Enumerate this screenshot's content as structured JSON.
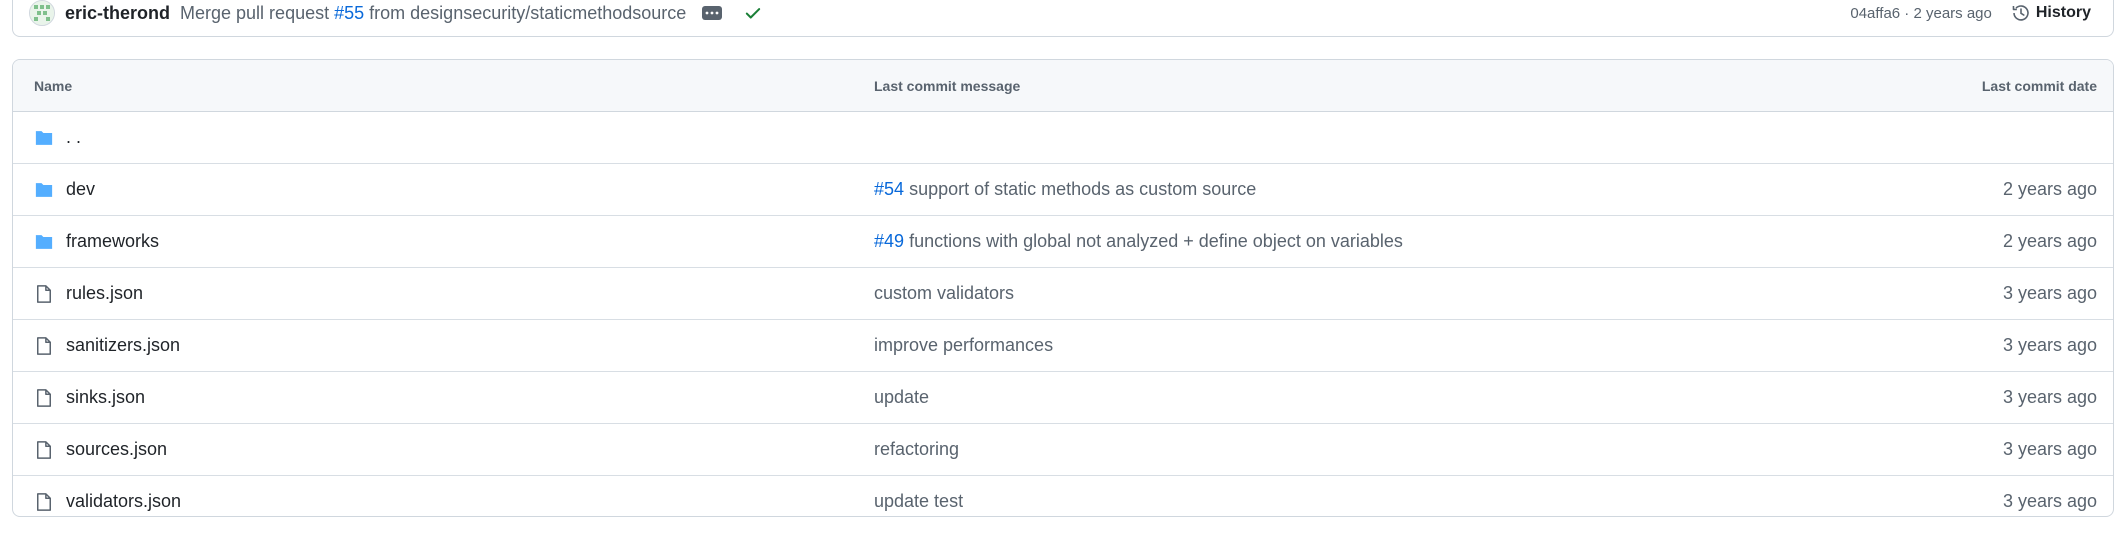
{
  "commit": {
    "author": "eric-therond",
    "message_prefix": "Merge pull request ",
    "pr_ref": "#55",
    "message_suffix": " from designsecurity/staticmethodsource",
    "sha": "04affa6",
    "separator": " · ",
    "age": "2 years ago",
    "history_label": "History",
    "status": "success",
    "status_color": "#1a7f37"
  },
  "table": {
    "headers": {
      "name": "Name",
      "message": "Last commit message",
      "date": "Last commit date"
    },
    "parent": {
      "label": ". .",
      "icon": "folder-icon"
    },
    "rows": [
      {
        "name": "dev",
        "type": "folder",
        "icon": "folder-icon",
        "pr": "#54",
        "message": "support of static methods as custom source",
        "date": "2 years ago"
      },
      {
        "name": "frameworks",
        "type": "folder",
        "icon": "folder-icon",
        "pr": "#49",
        "message": "functions with global not analyzed + define object on variables",
        "date": "2 years ago"
      },
      {
        "name": "rules.json",
        "type": "file",
        "icon": "file-icon",
        "pr": "",
        "message": "custom validators",
        "date": "3 years ago"
      },
      {
        "name": "sanitizers.json",
        "type": "file",
        "icon": "file-icon",
        "pr": "",
        "message": "improve performances",
        "date": "3 years ago"
      },
      {
        "name": "sinks.json",
        "type": "file",
        "icon": "file-icon",
        "pr": "",
        "message": "update",
        "date": "3 years ago"
      },
      {
        "name": "sources.json",
        "type": "file",
        "icon": "file-icon",
        "pr": "",
        "message": "refactoring",
        "date": "3 years ago"
      },
      {
        "name": "validators.json",
        "type": "file",
        "icon": "file-icon",
        "pr": "",
        "message": "update test",
        "date": "3 years ago"
      }
    ]
  },
  "colors": {
    "link": "#0969da",
    "folder": "#54aeff",
    "muted": "#59636e",
    "border": "#d0d7de"
  }
}
